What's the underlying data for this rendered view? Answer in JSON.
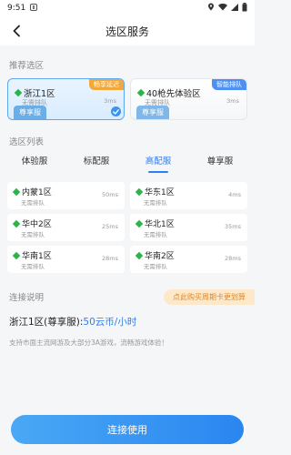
{
  "status_bar": {
    "time": "9:51"
  },
  "header": {
    "title": "选区服务"
  },
  "recommended": {
    "label": "推荐选区",
    "cards": [
      {
        "name": "浙江1区",
        "sub": "无需排队",
        "ms": "3ms",
        "tier": "尊享服",
        "badge": "畅享延迟",
        "selected": true
      },
      {
        "name": "40枪先体验区",
        "sub": "无需排队",
        "ms": "3ms",
        "tier": "尊享服",
        "badge": "智能排队",
        "selected": false
      }
    ]
  },
  "list": {
    "label": "选区列表",
    "tabs": [
      "体验服",
      "标配服",
      "高配服",
      "尊享服"
    ],
    "active_tab": "高配服",
    "servers": [
      {
        "name": "内蒙1区",
        "sub": "无需排队",
        "ms": "50ms"
      },
      {
        "name": "华东1区",
        "sub": "无需排队",
        "ms": "4ms"
      },
      {
        "name": "华中2区",
        "sub": "无需排队",
        "ms": "25ms"
      },
      {
        "name": "华北1区",
        "sub": "无需排队",
        "ms": "35ms"
      },
      {
        "name": "华南1区",
        "sub": "无需排队",
        "ms": "28ms"
      },
      {
        "name": "华南2区",
        "sub": "无需排队",
        "ms": "28ms"
      }
    ]
  },
  "connection": {
    "label": "连接说明",
    "promo": "点此购买周期卡更划算",
    "zone": "浙江1区(尊享服):",
    "price": "50云币/小时",
    "description": "支持市面主流网游及大部分3A游戏，流畅游戏体验！"
  },
  "actions": {
    "connect": "连接使用"
  },
  "colors": {
    "accent": "#2d7ef0",
    "region_dot": "#2cb34a",
    "promo_text": "#e08a2a"
  }
}
